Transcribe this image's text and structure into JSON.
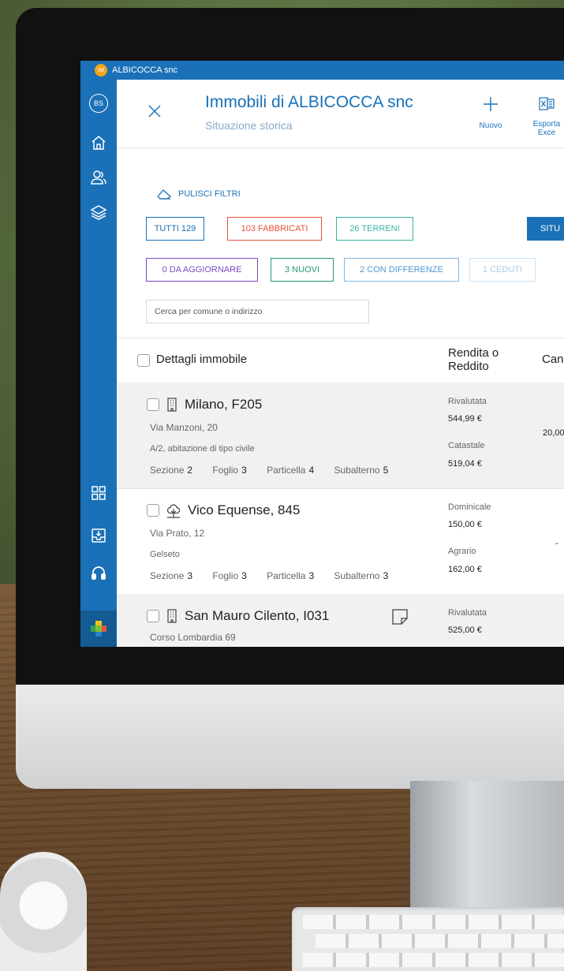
{
  "window": {
    "app_badge": "IM",
    "title": "ALBICOCCA snc"
  },
  "sidebar": {
    "avatar": "BS"
  },
  "header": {
    "title": "Immobili di ALBICOCCA snc",
    "subtitle": "Situazione storica",
    "new_label": "Nuovo",
    "export_label_1": "Esporta",
    "export_label_2": "Exce"
  },
  "filters": {
    "clear_label": "PULISCI FILTRI",
    "chips": {
      "tutti": "TUTTI 129",
      "fabbricati": "103 FABBRICATI",
      "terreni": "26 TERRENI",
      "situazione": "SITU",
      "da_aggiornare": "0 DA AGGIORNARE",
      "nuovi": "3 NUOVI",
      "con_differenze": "2 CON DIFFERENZE",
      "ceduti": "1 CEDUTI"
    },
    "search_placeholder": "Cerca per comune o indirizzo"
  },
  "table": {
    "col_details": "Dettagli immobile",
    "col_rendita_1": "Rendita o",
    "col_rendita_2": "Reddito",
    "col_can": "Can",
    "rows": [
      {
        "title": "Milano, F205",
        "address": "Via Manzoni, 20",
        "type": "A/2, abitazione di tipo civile",
        "sezione_label": "Sezione",
        "sezione": "2",
        "foglio_label": "Foglio",
        "foglio": "3",
        "particella_label": "Particella",
        "particella": "4",
        "subalterno_label": "Subalterno",
        "subalterno": "5",
        "r1_label": "Rivalutata",
        "r1_value": "544,99 €",
        "r2_label": "Catastale",
        "r2_value": "519,04 €",
        "can": "20,00"
      },
      {
        "title": "Vico Equense, 845",
        "address": "Via Prato, 12",
        "type": "Gelseto",
        "sezione_label": "Sezione",
        "sezione": "3",
        "foglio_label": "Foglio",
        "foglio": "3",
        "particella_label": "Particella",
        "particella": "3",
        "subalterno_label": "Subalterno",
        "subalterno": "3",
        "r1_label": "Dominicale",
        "r1_value": "150,00 €",
        "r2_label": "Agrario",
        "r2_value": "162,00 €",
        "can": "-"
      },
      {
        "title": "San Mauro Cilento, I031",
        "address": "Corso Lombardia 69",
        "r1_label": "Rivalutata",
        "r1_value": "525,00 €"
      }
    ]
  },
  "colors": {
    "brand_blue": "#1a71b8",
    "fabbricati": "#e8533a",
    "terreni": "#3ab3a3",
    "da_aggiornare": "#7a4bc4",
    "nuovi": "#1f9a7a"
  }
}
